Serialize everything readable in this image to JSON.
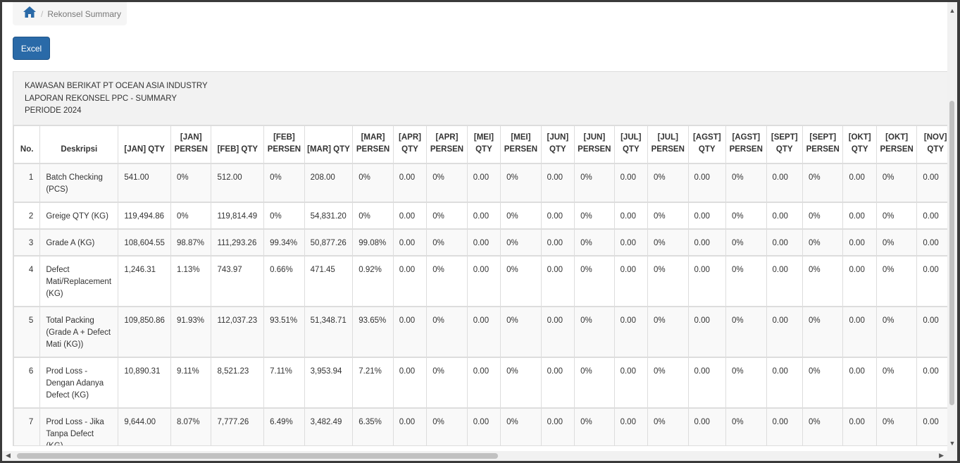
{
  "breadcrumb": {
    "current": "Rekonsel Summary",
    "separator": "/"
  },
  "toolbar": {
    "excel_label": "Excel"
  },
  "report": {
    "line1": "KAWASAN BERIKAT PT OCEAN ASIA INDUSTRY",
    "line2": "LAPORAN REKONSEL PPC - SUMMARY",
    "line3": "PERIODE 2024"
  },
  "table": {
    "headers": [
      "No.",
      "Deskripsi",
      "[JAN] QTY",
      "[JAN] PERSEN",
      "[FEB] QTY",
      "[FEB] PERSEN",
      "[MAR] QTY",
      "[MAR] PERSEN",
      "[APR] QTY",
      "[APR] PERSEN",
      "[MEI] QTY",
      "[MEI] PERSEN",
      "[JUN] QTY",
      "[JUN] PERSEN",
      "[JUL] QTY",
      "[JUL] PERSEN",
      "[AGST] QTY",
      "[AGST] PERSEN",
      "[SEPT] QTY",
      "[SEPT] PERSEN",
      "[OKT] QTY",
      "[OKT] PERSEN",
      "[NOV] QTY"
    ],
    "rows": [
      [
        "1",
        "Batch Checking (PCS)",
        "541.00",
        "0%",
        "512.00",
        "0%",
        "208.00",
        "0%",
        "0.00",
        "0%",
        "0.00",
        "0%",
        "0.00",
        "0%",
        "0.00",
        "0%",
        "0.00",
        "0%",
        "0.00",
        "0%",
        "0.00",
        "0%",
        "0.00"
      ],
      [
        "2",
        "Greige QTY (KG)",
        "119,494.86",
        "0%",
        "119,814.49",
        "0%",
        "54,831.20",
        "0%",
        "0.00",
        "0%",
        "0.00",
        "0%",
        "0.00",
        "0%",
        "0.00",
        "0%",
        "0.00",
        "0%",
        "0.00",
        "0%",
        "0.00",
        "0%",
        "0.00"
      ],
      [
        "3",
        "Grade A (KG)",
        "108,604.55",
        "98.87%",
        "111,293.26",
        "99.34%",
        "50,877.26",
        "99.08%",
        "0.00",
        "0%",
        "0.00",
        "0%",
        "0.00",
        "0%",
        "0.00",
        "0%",
        "0.00",
        "0%",
        "0.00",
        "0%",
        "0.00",
        "0%",
        "0.00"
      ],
      [
        "4",
        "Defect Mati/Replacement (KG)",
        "1,246.31",
        "1.13%",
        "743.97",
        "0.66%",
        "471.45",
        "0.92%",
        "0.00",
        "0%",
        "0.00",
        "0%",
        "0.00",
        "0%",
        "0.00",
        "0%",
        "0.00",
        "0%",
        "0.00",
        "0%",
        "0.00",
        "0%",
        "0.00"
      ],
      [
        "5",
        "Total Packing (Grade A + Defect Mati (KG))",
        "109,850.86",
        "91.93%",
        "112,037.23",
        "93.51%",
        "51,348.71",
        "93.65%",
        "0.00",
        "0%",
        "0.00",
        "0%",
        "0.00",
        "0%",
        "0.00",
        "0%",
        "0.00",
        "0%",
        "0.00",
        "0%",
        "0.00",
        "0%",
        "0.00"
      ],
      [
        "6",
        "Prod Loss - Dengan Adanya Defect (KG)",
        "10,890.31",
        "9.11%",
        "8,521.23",
        "7.11%",
        "3,953.94",
        "7.21%",
        "0.00",
        "0%",
        "0.00",
        "0%",
        "0.00",
        "0%",
        "0.00",
        "0%",
        "0.00",
        "0%",
        "0.00",
        "0%",
        "0.00",
        "0%",
        "0.00"
      ],
      [
        "7",
        "Prod Loss - Jika Tanpa Defect (KG)",
        "9,644.00",
        "8.07%",
        "7,777.26",
        "6.49%",
        "3,482.49",
        "6.35%",
        "0.00",
        "0%",
        "0.00",
        "0%",
        "0.00",
        "0%",
        "0.00",
        "0%",
        "0.00",
        "0%",
        "0.00",
        "0%",
        "0.00",
        "0%",
        "0.00"
      ]
    ]
  },
  "icons": {
    "home": "home-icon"
  },
  "colors": {
    "button": "#2a6aa8",
    "home_icon": "#2a6aa8"
  }
}
